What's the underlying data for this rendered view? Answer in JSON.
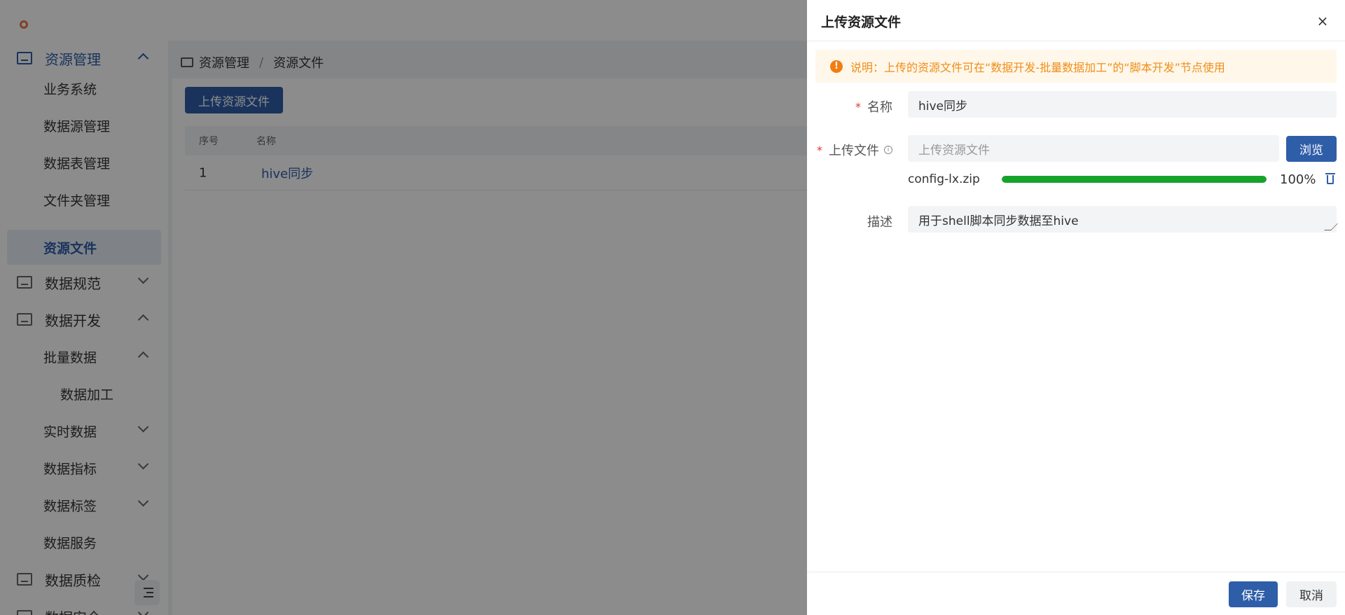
{
  "sidebar": {
    "items": [
      {
        "label": "资源管理"
      },
      {
        "label": "业务系统"
      },
      {
        "label": "数据源管理"
      },
      {
        "label": "数据表管理"
      },
      {
        "label": "文件夹管理"
      },
      {
        "label": "资源文件"
      },
      {
        "label": "数据规范"
      },
      {
        "label": "数据开发"
      },
      {
        "label": "批量数据"
      },
      {
        "label": "数据加工"
      },
      {
        "label": "实时数据"
      },
      {
        "label": "数据指标"
      },
      {
        "label": "数据标签"
      },
      {
        "label": "数据服务"
      },
      {
        "label": "数据质检"
      },
      {
        "label": "数据安全"
      }
    ]
  },
  "breadcrumb": {
    "root": "资源管理",
    "separator": "/",
    "current": "资源文件"
  },
  "main": {
    "upload_button": "上传资源文件",
    "table": {
      "columns": [
        "序号",
        "名称"
      ],
      "rows": [
        {
          "index": "1",
          "name": "hive同步"
        }
      ]
    }
  },
  "drawer": {
    "title": "上传资源文件",
    "close": "×",
    "alert": "说明：上传的资源文件可在“数据开发-批量数据加工”的“脚本开发”节点使用",
    "alert_icon": "!",
    "required_mark": "*",
    "name_label": "名称",
    "name_value": "hive同步",
    "file_label": "上传文件",
    "info_icon": "i",
    "file_placeholder": "上传资源文件",
    "browse_button": "浏览",
    "upload": {
      "file_name": "config-lx.zip",
      "progress": 100,
      "progress_text": "100%"
    },
    "desc_label": "描述",
    "desc_value": "用于shell脚本同步数据至hive",
    "save_button": "保存",
    "cancel_button": "取消"
  },
  "colors": {
    "primary": "#2f5ea8",
    "success": "#16a32c",
    "warning": "#ef8e17",
    "required": "#e8362f"
  }
}
